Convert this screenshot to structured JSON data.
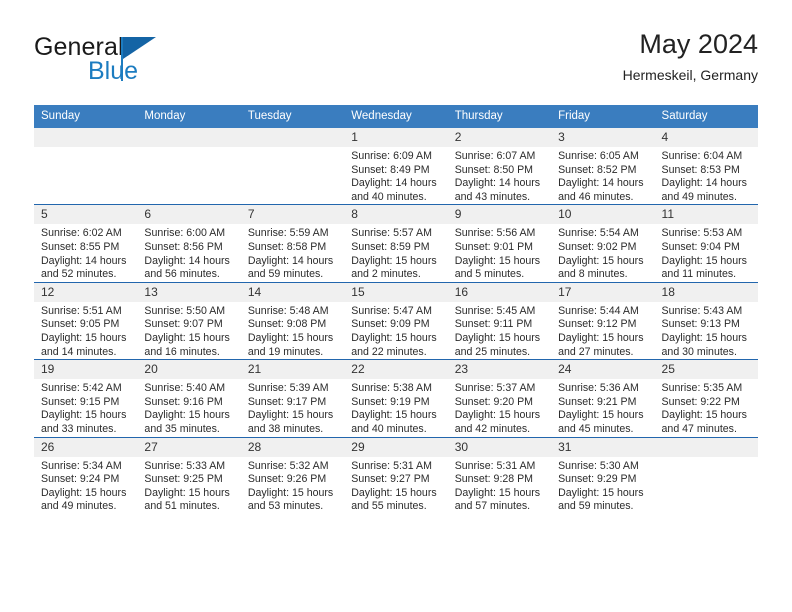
{
  "brand": {
    "word_general": "General",
    "word_blue": "Blue",
    "logo_icon": "triangle-flag-icon"
  },
  "header": {
    "title": "May 2024",
    "location": "Hermeskeil, Germany"
  },
  "colors": {
    "header_blue": "#3a7dbf",
    "row_divider_blue": "#2266ad",
    "daynum_band": "#f0f0f0",
    "brand_blue": "#1c7cc0",
    "logo_blue": "#1464a5",
    "text": "#2b2b2b"
  },
  "weekday_headers": [
    "Sunday",
    "Monday",
    "Tuesday",
    "Wednesday",
    "Thursday",
    "Friday",
    "Saturday"
  ],
  "labels": {
    "sunrise_prefix": "Sunrise:",
    "sunset_prefix": "Sunset:",
    "daylight_prefix": "Daylight:"
  },
  "weeks": [
    [
      {
        "day": "",
        "empty": true,
        "line1": "",
        "line2": "",
        "line3": "",
        "line4": ""
      },
      {
        "day": "",
        "empty": true,
        "line1": "",
        "line2": "",
        "line3": "",
        "line4": ""
      },
      {
        "day": "",
        "empty": true,
        "line1": "",
        "line2": "",
        "line3": "",
        "line4": ""
      },
      {
        "day": "1",
        "empty": false,
        "line1": "Sunrise: 6:09 AM",
        "line2": "Sunset: 8:49 PM",
        "line3": "Daylight: 14 hours",
        "line4": "and 40 minutes."
      },
      {
        "day": "2",
        "empty": false,
        "line1": "Sunrise: 6:07 AM",
        "line2": "Sunset: 8:50 PM",
        "line3": "Daylight: 14 hours",
        "line4": "and 43 minutes."
      },
      {
        "day": "3",
        "empty": false,
        "line1": "Sunrise: 6:05 AM",
        "line2": "Sunset: 8:52 PM",
        "line3": "Daylight: 14 hours",
        "line4": "and 46 minutes."
      },
      {
        "day": "4",
        "empty": false,
        "line1": "Sunrise: 6:04 AM",
        "line2": "Sunset: 8:53 PM",
        "line3": "Daylight: 14 hours",
        "line4": "and 49 minutes."
      }
    ],
    [
      {
        "day": "5",
        "empty": false,
        "line1": "Sunrise: 6:02 AM",
        "line2": "Sunset: 8:55 PM",
        "line3": "Daylight: 14 hours",
        "line4": "and 52 minutes."
      },
      {
        "day": "6",
        "empty": false,
        "line1": "Sunrise: 6:00 AM",
        "line2": "Sunset: 8:56 PM",
        "line3": "Daylight: 14 hours",
        "line4": "and 56 minutes."
      },
      {
        "day": "7",
        "empty": false,
        "line1": "Sunrise: 5:59 AM",
        "line2": "Sunset: 8:58 PM",
        "line3": "Daylight: 14 hours",
        "line4": "and 59 minutes."
      },
      {
        "day": "8",
        "empty": false,
        "line1": "Sunrise: 5:57 AM",
        "line2": "Sunset: 8:59 PM",
        "line3": "Daylight: 15 hours",
        "line4": "and 2 minutes."
      },
      {
        "day": "9",
        "empty": false,
        "line1": "Sunrise: 5:56 AM",
        "line2": "Sunset: 9:01 PM",
        "line3": "Daylight: 15 hours",
        "line4": "and 5 minutes."
      },
      {
        "day": "10",
        "empty": false,
        "line1": "Sunrise: 5:54 AM",
        "line2": "Sunset: 9:02 PM",
        "line3": "Daylight: 15 hours",
        "line4": "and 8 minutes."
      },
      {
        "day": "11",
        "empty": false,
        "line1": "Sunrise: 5:53 AM",
        "line2": "Sunset: 9:04 PM",
        "line3": "Daylight: 15 hours",
        "line4": "and 11 minutes."
      }
    ],
    [
      {
        "day": "12",
        "empty": false,
        "line1": "Sunrise: 5:51 AM",
        "line2": "Sunset: 9:05 PM",
        "line3": "Daylight: 15 hours",
        "line4": "and 14 minutes."
      },
      {
        "day": "13",
        "empty": false,
        "line1": "Sunrise: 5:50 AM",
        "line2": "Sunset: 9:07 PM",
        "line3": "Daylight: 15 hours",
        "line4": "and 16 minutes."
      },
      {
        "day": "14",
        "empty": false,
        "line1": "Sunrise: 5:48 AM",
        "line2": "Sunset: 9:08 PM",
        "line3": "Daylight: 15 hours",
        "line4": "and 19 minutes."
      },
      {
        "day": "15",
        "empty": false,
        "line1": "Sunrise: 5:47 AM",
        "line2": "Sunset: 9:09 PM",
        "line3": "Daylight: 15 hours",
        "line4": "and 22 minutes."
      },
      {
        "day": "16",
        "empty": false,
        "line1": "Sunrise: 5:45 AM",
        "line2": "Sunset: 9:11 PM",
        "line3": "Daylight: 15 hours",
        "line4": "and 25 minutes."
      },
      {
        "day": "17",
        "empty": false,
        "line1": "Sunrise: 5:44 AM",
        "line2": "Sunset: 9:12 PM",
        "line3": "Daylight: 15 hours",
        "line4": "and 27 minutes."
      },
      {
        "day": "18",
        "empty": false,
        "line1": "Sunrise: 5:43 AM",
        "line2": "Sunset: 9:13 PM",
        "line3": "Daylight: 15 hours",
        "line4": "and 30 minutes."
      }
    ],
    [
      {
        "day": "19",
        "empty": false,
        "line1": "Sunrise: 5:42 AM",
        "line2": "Sunset: 9:15 PM",
        "line3": "Daylight: 15 hours",
        "line4": "and 33 minutes."
      },
      {
        "day": "20",
        "empty": false,
        "line1": "Sunrise: 5:40 AM",
        "line2": "Sunset: 9:16 PM",
        "line3": "Daylight: 15 hours",
        "line4": "and 35 minutes."
      },
      {
        "day": "21",
        "empty": false,
        "line1": "Sunrise: 5:39 AM",
        "line2": "Sunset: 9:17 PM",
        "line3": "Daylight: 15 hours",
        "line4": "and 38 minutes."
      },
      {
        "day": "22",
        "empty": false,
        "line1": "Sunrise: 5:38 AM",
        "line2": "Sunset: 9:19 PM",
        "line3": "Daylight: 15 hours",
        "line4": "and 40 minutes."
      },
      {
        "day": "23",
        "empty": false,
        "line1": "Sunrise: 5:37 AM",
        "line2": "Sunset: 9:20 PM",
        "line3": "Daylight: 15 hours",
        "line4": "and 42 minutes."
      },
      {
        "day": "24",
        "empty": false,
        "line1": "Sunrise: 5:36 AM",
        "line2": "Sunset: 9:21 PM",
        "line3": "Daylight: 15 hours",
        "line4": "and 45 minutes."
      },
      {
        "day": "25",
        "empty": false,
        "line1": "Sunrise: 5:35 AM",
        "line2": "Sunset: 9:22 PM",
        "line3": "Daylight: 15 hours",
        "line4": "and 47 minutes."
      }
    ],
    [
      {
        "day": "26",
        "empty": false,
        "line1": "Sunrise: 5:34 AM",
        "line2": "Sunset: 9:24 PM",
        "line3": "Daylight: 15 hours",
        "line4": "and 49 minutes."
      },
      {
        "day": "27",
        "empty": false,
        "line1": "Sunrise: 5:33 AM",
        "line2": "Sunset: 9:25 PM",
        "line3": "Daylight: 15 hours",
        "line4": "and 51 minutes."
      },
      {
        "day": "28",
        "empty": false,
        "line1": "Sunrise: 5:32 AM",
        "line2": "Sunset: 9:26 PM",
        "line3": "Daylight: 15 hours",
        "line4": "and 53 minutes."
      },
      {
        "day": "29",
        "empty": false,
        "line1": "Sunrise: 5:31 AM",
        "line2": "Sunset: 9:27 PM",
        "line3": "Daylight: 15 hours",
        "line4": "and 55 minutes."
      },
      {
        "day": "30",
        "empty": false,
        "line1": "Sunrise: 5:31 AM",
        "line2": "Sunset: 9:28 PM",
        "line3": "Daylight: 15 hours",
        "line4": "and 57 minutes."
      },
      {
        "day": "31",
        "empty": false,
        "line1": "Sunrise: 5:30 AM",
        "line2": "Sunset: 9:29 PM",
        "line3": "Daylight: 15 hours",
        "line4": "and 59 minutes."
      },
      {
        "day": "",
        "empty": true,
        "line1": "",
        "line2": "",
        "line3": "",
        "line4": ""
      }
    ]
  ]
}
